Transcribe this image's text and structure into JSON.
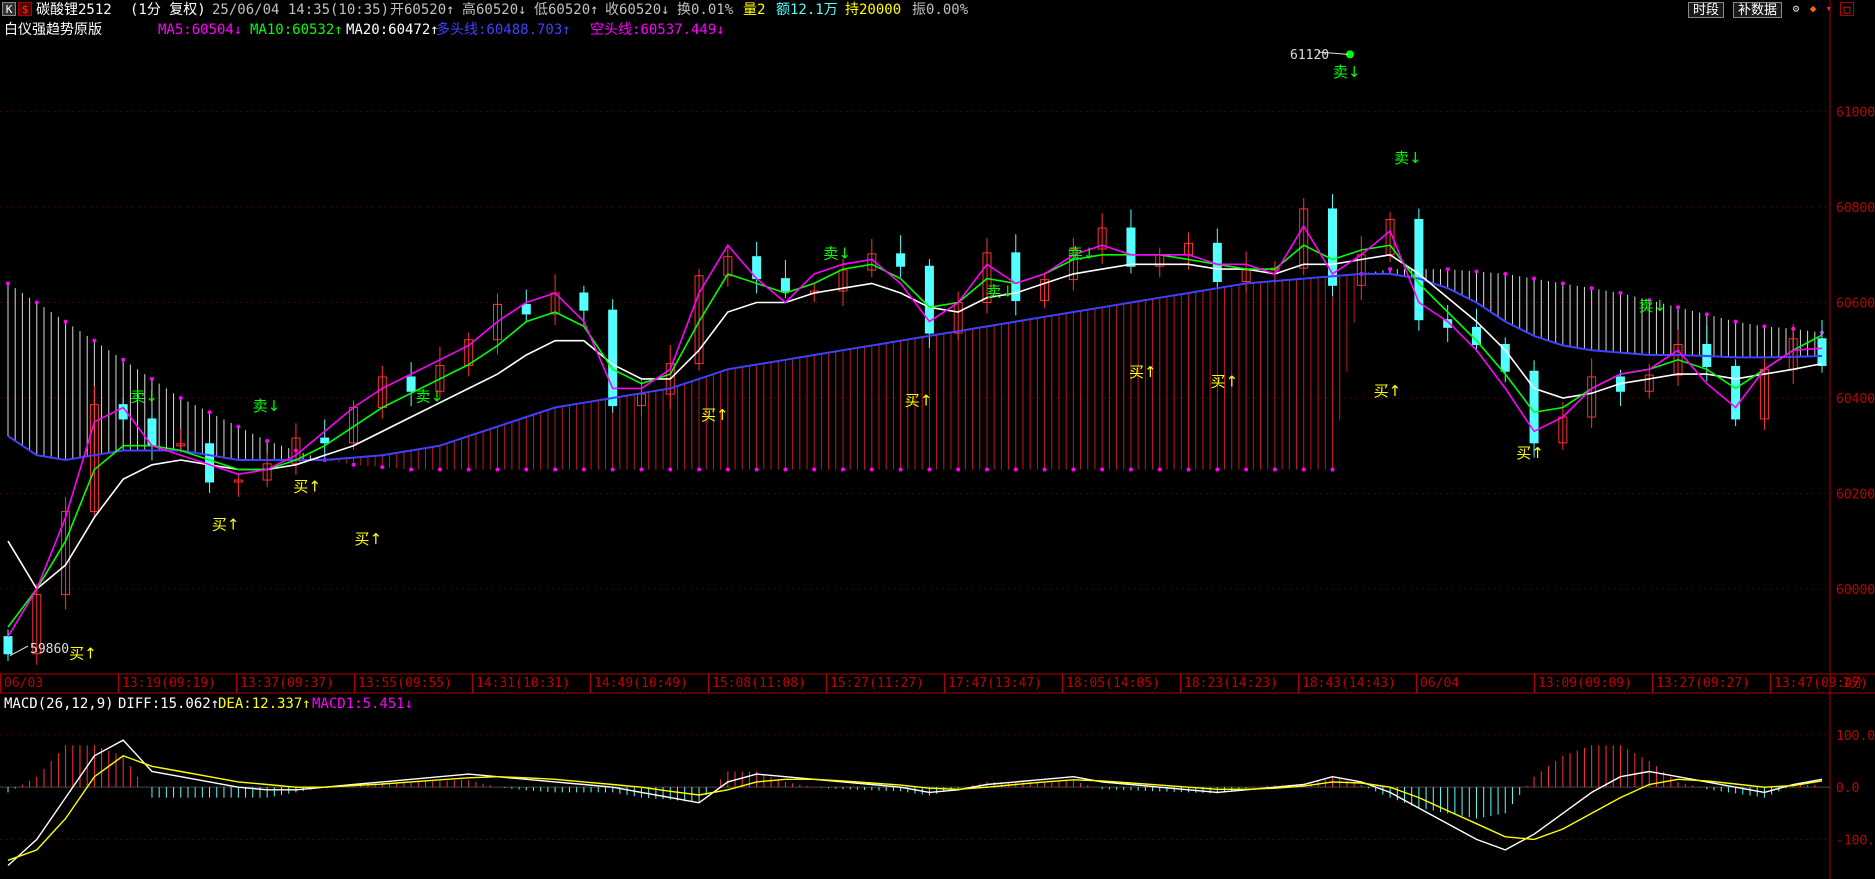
{
  "header": {
    "k_icon": "K",
    "dollar_icon": "$",
    "symbol": "碳酸锂2512",
    "period": "(1分 复权)",
    "datetime": "25/06/04 14:35(10:35)",
    "open": "开60520↑",
    "high": "高60520↓",
    "low": "低60520↑",
    "close": "收60520↓",
    "turnover": "换0.01%",
    "volume": "量2",
    "amount": "额12.1万",
    "position": "持20000",
    "amplitude": "振0.00%",
    "btn_time": "时段",
    "btn_data": "补数据",
    "gear_icon": "gear-icon",
    "diamond_icon": "diamond-icon",
    "arrow_icon": "chevron-down-icon",
    "close_icon": "close-icon"
  },
  "indicators": {
    "name": "白仪强趋势原版",
    "ma5": "MA5:60504↓",
    "ma10": "MA10:60532↑",
    "ma20": "MA20:60472↑",
    "long_line": "多头线:60488.703↑",
    "short_line": "空头线:60537.449↓"
  },
  "macd": {
    "name": "MACD(26,12,9)",
    "diff": "DIFF:15.062↑",
    "dea": "DEA:12.337↑",
    "macd1": "MACD1:5.451↓"
  },
  "time_axis": {
    "labels": [
      "06/03",
      "13:19(09:19)",
      "13:37(09:37)",
      "13:55(09:55)",
      "14:31(10:31)",
      "14:49(10:49)",
      "15:08(11:08)",
      "15:27(11:27)",
      "17:47(13:47)",
      "18:05(14:05)",
      "18:23(14:23)",
      "18:43(14:43)",
      "06/04",
      "13:09(09:09)",
      "13:27(09:27)",
      "13:47(09:47)"
    ],
    "period_label": "1分"
  },
  "annotations": {
    "high_label": "61120",
    "low_label": "59860",
    "buy_label": "买↑",
    "sell_label": "卖↓"
  },
  "colors": {
    "up": "#ff3232",
    "down": "#54ffff",
    "ma5": "#ff00ff",
    "ma10": "#00ff00",
    "ma20": "#ffffff",
    "long_line": "#4040ff",
    "short_line": "#ff00ff",
    "axis": "#b00000",
    "buy": "#ffff00",
    "sell": "#00ff00"
  },
  "chart_data": [
    {
      "type": "candlestick",
      "y_axis_ticks": [
        61000,
        60800,
        60600,
        60400,
        60200,
        60000
      ],
      "ylim": [
        59830,
        61150
      ],
      "high": 61120,
      "low": 59860,
      "ma5": [
        59900,
        60000,
        60150,
        60350,
        60380,
        60300,
        60280,
        60260,
        60240,
        60250,
        60280,
        60330,
        60380,
        60420,
        60450,
        60480,
        60510,
        60560,
        60600,
        60620,
        60560,
        60420,
        60420,
        60460,
        60620,
        60720,
        60650,
        60600,
        60660,
        60680,
        60690,
        60640,
        60560,
        60600,
        60680,
        60640,
        60660,
        60700,
        60720,
        60700,
        60700,
        60700,
        60680,
        60680,
        60660,
        60760,
        60660,
        60700,
        60750,
        60600,
        60560,
        60500,
        60420,
        60330,
        60360,
        60420,
        60450,
        60460,
        60500,
        60430,
        60380,
        60460,
        60500,
        60504
      ],
      "ma10": [
        59920,
        60000,
        60100,
        60250,
        60300,
        60300,
        60290,
        60270,
        60250,
        60250,
        60270,
        60300,
        60340,
        60380,
        60410,
        60440,
        60470,
        60510,
        60560,
        60580,
        60550,
        60460,
        60430,
        60450,
        60560,
        60660,
        60640,
        60620,
        60640,
        60670,
        60680,
        60650,
        60590,
        60600,
        60650,
        60640,
        60660,
        60690,
        60700,
        60700,
        60700,
        60690,
        60680,
        60670,
        60670,
        60720,
        60690,
        60710,
        60720,
        60640,
        60580,
        60520,
        60450,
        60370,
        60380,
        60420,
        60450,
        60460,
        60480,
        60460,
        60420,
        60460,
        60500,
        60532
      ],
      "ma20": [
        60100,
        60000,
        60050,
        60150,
        60230,
        60260,
        60270,
        60260,
        60250,
        60250,
        60260,
        60280,
        60300,
        60330,
        60360,
        60390,
        60420,
        60450,
        60490,
        60520,
        60520,
        60470,
        60440,
        60440,
        60500,
        60580,
        60600,
        60600,
        60620,
        60630,
        60640,
        60620,
        60590,
        60580,
        60610,
        60620,
        60640,
        60660,
        60670,
        60680,
        60680,
        60680,
        60670,
        60670,
        60660,
        60680,
        60680,
        60690,
        60700,
        60660,
        60610,
        60560,
        60500,
        60420,
        60400,
        60410,
        60430,
        60440,
        60450,
        60450,
        60440,
        60450,
        60460,
        60472
      ],
      "long_line": [
        60320,
        60280,
        60270,
        60280,
        60290,
        60290,
        60290,
        60280,
        60270,
        60270,
        60270,
        60270,
        60275,
        60280,
        60290,
        60300,
        60320,
        60340,
        60360,
        60380,
        60390,
        60400,
        60410,
        60420,
        60440,
        60460,
        60470,
        60480,
        60490,
        60500,
        60510,
        60520,
        60530,
        60540,
        60550,
        60560,
        60570,
        60580,
        60590,
        60600,
        60610,
        60620,
        60630,
        60640,
        60645,
        60650,
        60655,
        60660,
        60660,
        60650,
        60630,
        60600,
        60560,
        60530,
        60510,
        60500,
        60495,
        60490,
        60490,
        60488,
        60485,
        60485,
        60486,
        60488
      ],
      "short_line": [
        60640,
        60600,
        60560,
        60520,
        60480,
        60440,
        60400,
        60370,
        60340,
        60310,
        60290,
        60270,
        60260,
        60255,
        60250,
        60250,
        60250,
        60250,
        60250,
        60250,
        60250,
        60250,
        60250,
        60250,
        60250,
        60250,
        60250,
        60250,
        60250,
        60250,
        60250,
        60250,
        60250,
        60250,
        60250,
        60250,
        60250,
        60250,
        60250,
        60250,
        60250,
        60250,
        60250,
        60250,
        60250,
        60250,
        60250,
        60660,
        60670,
        60670,
        60670,
        60665,
        60660,
        60650,
        60640,
        60630,
        60620,
        60605,
        60590,
        60575,
        60560,
        60550,
        60545,
        60537
      ],
      "buy_signals": [
        [
          3,
          59900
        ],
        [
          10,
          60170
        ],
        [
          14,
          60250
        ],
        [
          17,
          60140
        ],
        [
          34,
          60400
        ],
        [
          44,
          60430
        ],
        [
          55,
          60490
        ],
        [
          59,
          60470
        ],
        [
          67,
          60450
        ],
        [
          74,
          60320
        ]
      ],
      "sell_signals": [
        [
          6,
          60380
        ],
        [
          12,
          60360
        ],
        [
          20,
          60380
        ],
        [
          40,
          60680
        ],
        [
          48,
          60600
        ],
        [
          52,
          60680
        ],
        [
          65,
          61060
        ],
        [
          68,
          60880
        ],
        [
          80,
          60570
        ]
      ]
    },
    {
      "type": "bar",
      "title": "MACD(26,12,9)",
      "y_axis_ticks": [
        100.0,
        0.0,
        -100.0
      ],
      "ylim": [
        -170,
        140
      ],
      "diff": [
        -150,
        -100,
        -20,
        60,
        90,
        30,
        20,
        10,
        0,
        -5,
        -5,
        0,
        5,
        10,
        15,
        20,
        25,
        20,
        15,
        10,
        5,
        0,
        -10,
        -20,
        -30,
        10,
        25,
        20,
        15,
        10,
        5,
        0,
        -10,
        -5,
        5,
        10,
        15,
        20,
        10,
        5,
        0,
        -5,
        -10,
        -5,
        0,
        5,
        20,
        10,
        -10,
        -40,
        -70,
        -100,
        -120,
        -90,
        -50,
        -10,
        20,
        30,
        20,
        10,
        0,
        -10,
        5,
        15
      ],
      "dea": [
        -140,
        -120,
        -60,
        20,
        60,
        40,
        30,
        20,
        10,
        5,
        0,
        0,
        3,
        6,
        10,
        14,
        18,
        20,
        18,
        15,
        10,
        5,
        0,
        -8,
        -15,
        -5,
        10,
        15,
        15,
        12,
        8,
        4,
        -2,
        -4,
        0,
        5,
        10,
        14,
        12,
        8,
        4,
        0,
        -4,
        -4,
        -2,
        2,
        10,
        8,
        0,
        -20,
        -45,
        -70,
        -95,
        -100,
        -80,
        -50,
        -20,
        5,
        15,
        12,
        6,
        0,
        3,
        12
      ],
      "macd_hist": [
        -10,
        20,
        80,
        80,
        60,
        -20,
        -20,
        -20,
        -20,
        -20,
        -10,
        0,
        4,
        8,
        10,
        12,
        14,
        0,
        -6,
        -10,
        -10,
        -10,
        -20,
        -24,
        -30,
        30,
        30,
        10,
        0,
        -4,
        -6,
        -8,
        -16,
        -2,
        10,
        10,
        10,
        12,
        -4,
        -6,
        -8,
        -10,
        -12,
        -2,
        4,
        6,
        20,
        4,
        -20,
        -40,
        -50,
        -60,
        -50,
        20,
        60,
        80,
        80,
        50,
        10,
        -4,
        -12,
        -20,
        4,
        5
      ]
    }
  ]
}
